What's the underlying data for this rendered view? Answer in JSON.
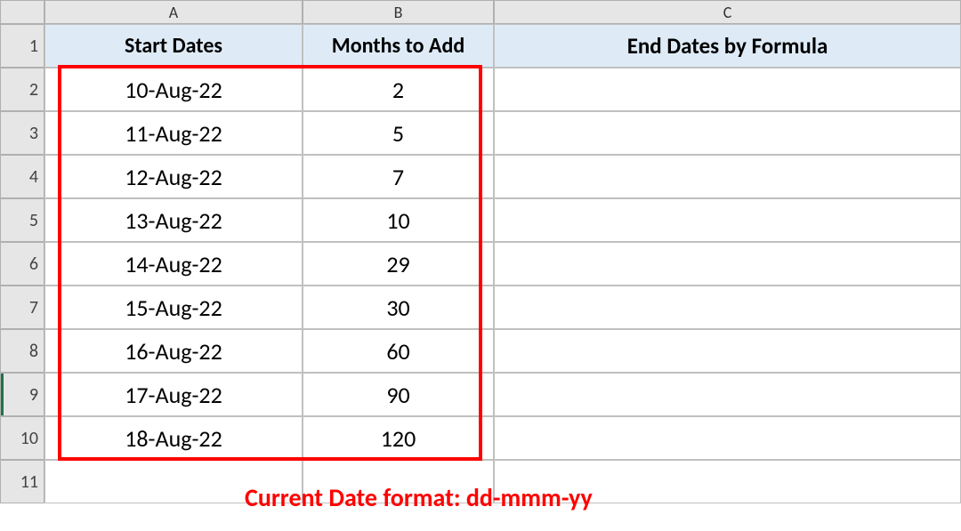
{
  "columns": [
    "A",
    "B",
    "C"
  ],
  "rowNumbers": [
    "1",
    "2",
    "3",
    "4",
    "5",
    "6",
    "7",
    "8",
    "9",
    "10",
    "11"
  ],
  "headers": {
    "A": "Start Dates",
    "B": "Months to Add",
    "C": "End Dates by Formula"
  },
  "rows": [
    {
      "A": "10-Aug-22",
      "B": "2",
      "C": ""
    },
    {
      "A": "11-Aug-22",
      "B": "5",
      "C": ""
    },
    {
      "A": "12-Aug-22",
      "B": "7",
      "C": ""
    },
    {
      "A": "13-Aug-22",
      "B": "10",
      "C": ""
    },
    {
      "A": "14-Aug-22",
      "B": "29",
      "C": ""
    },
    {
      "A": "15-Aug-22",
      "B": "30",
      "C": ""
    },
    {
      "A": "16-Aug-22",
      "B": "60",
      "C": ""
    },
    {
      "A": "17-Aug-22",
      "B": "90",
      "C": ""
    },
    {
      "A": "18-Aug-22",
      "B": "120",
      "C": ""
    }
  ],
  "annotation": "Current Date format: dd-mmm-yy",
  "selectedRow": "9"
}
